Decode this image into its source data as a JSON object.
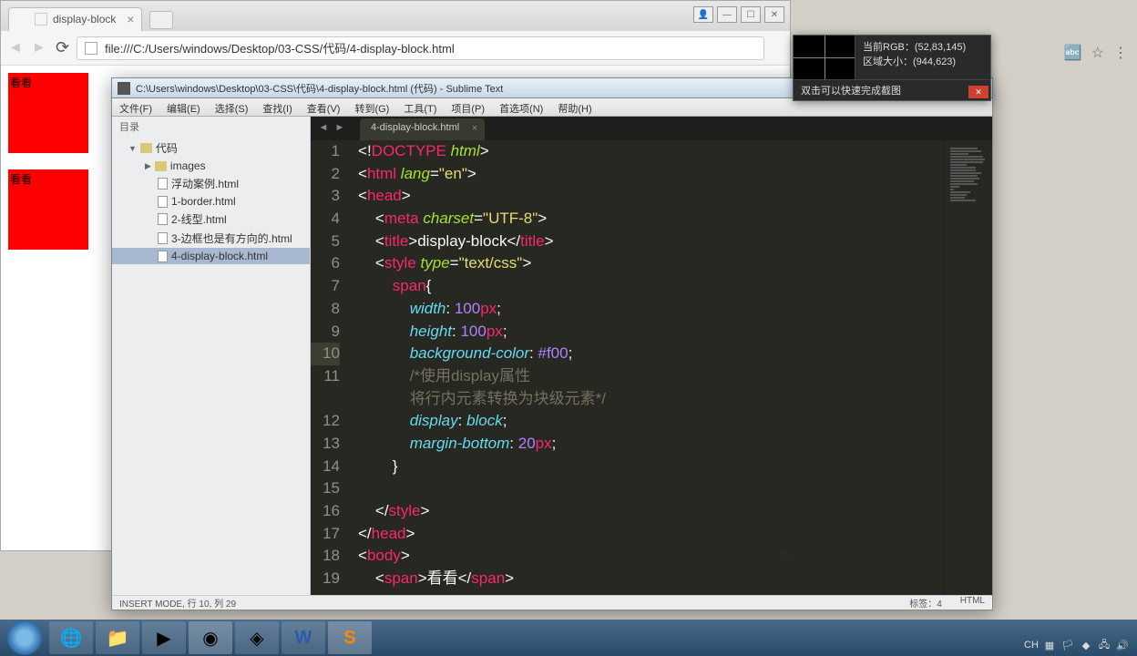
{
  "browser": {
    "tab_title": "display-block",
    "url": "file:///C:/Users/windows/Desktop/03-CSS/代码/4-display-block.html",
    "red_box_text": "看看"
  },
  "sublime": {
    "title": "C:\\Users\\windows\\Desktop\\03-CSS\\代码\\4-display-block.html (代码) - Sublime Text",
    "menu": [
      "文件(F)",
      "编辑(E)",
      "选择(S)",
      "查找(I)",
      "查看(V)",
      "转到(G)",
      "工具(T)",
      "项目(P)",
      "首选项(N)",
      "帮助(H)"
    ],
    "sidebar_header": "目录",
    "tree": {
      "root": "代码",
      "folder": "images",
      "files": [
        "浮动案例.html",
        "1-border.html",
        "2-线型.html",
        "3-边框也是有方向的.html",
        "4-display-block.html"
      ]
    },
    "tab": "4-display-block.html",
    "status_left": "INSERT MODE, 行 10, 列 29",
    "status_tabs": "标签：4",
    "status_lang": "HTML"
  },
  "picker": {
    "rgb_label": "当前RGB：",
    "rgb_val": "(52,83,145)",
    "size_label": "区域大小：",
    "size_val": "(944,623)",
    "hint": "双击可以快速完成截图"
  },
  "code": {
    "lines": [
      {
        "n": "1",
        "seg": [
          [
            "c-text",
            "<"
          ],
          [
            "c-text",
            "!"
          ],
          [
            "c-tag",
            "DOCTYPE"
          ],
          [
            "c-text",
            " "
          ],
          [
            "c-attr",
            "html"
          ],
          [
            "c-text",
            ">"
          ]
        ]
      },
      {
        "n": "2",
        "seg": [
          [
            "c-text",
            "<"
          ],
          [
            "c-tag",
            "html"
          ],
          [
            "c-text",
            " "
          ],
          [
            "c-attr",
            "lang"
          ],
          [
            "c-text",
            "="
          ],
          [
            "c-str",
            "\"en\""
          ],
          [
            "c-text",
            ">"
          ]
        ]
      },
      {
        "n": "3",
        "seg": [
          [
            "c-text",
            "<"
          ],
          [
            "c-tag",
            "head"
          ],
          [
            "c-text",
            ">"
          ]
        ]
      },
      {
        "n": "4",
        "seg": [
          [
            "c-text",
            "    <"
          ],
          [
            "c-tag",
            "meta"
          ],
          [
            "c-text",
            " "
          ],
          [
            "c-attr",
            "charset"
          ],
          [
            "c-text",
            "="
          ],
          [
            "c-str",
            "\"UTF-8\""
          ],
          [
            "c-text",
            ">"
          ]
        ]
      },
      {
        "n": "5",
        "seg": [
          [
            "c-text",
            "    <"
          ],
          [
            "c-tag",
            "title"
          ],
          [
            "c-text",
            ">display-block</"
          ],
          [
            "c-tag",
            "title"
          ],
          [
            "c-text",
            ">"
          ]
        ]
      },
      {
        "n": "6",
        "seg": [
          [
            "c-text",
            "    <"
          ],
          [
            "c-tag",
            "style"
          ],
          [
            "c-text",
            " "
          ],
          [
            "c-attr",
            "type"
          ],
          [
            "c-text",
            "="
          ],
          [
            "c-str",
            "\"text/css\""
          ],
          [
            "c-text",
            ">"
          ]
        ]
      },
      {
        "n": "7",
        "seg": [
          [
            "c-text",
            "        "
          ],
          [
            "c-tag",
            "span"
          ],
          [
            "c-text",
            "{"
          ]
        ]
      },
      {
        "n": "8",
        "seg": [
          [
            "c-text",
            "            "
          ],
          [
            "c-prop",
            "width"
          ],
          [
            "c-text",
            ": "
          ],
          [
            "c-num",
            "100"
          ],
          [
            "c-unit",
            "px"
          ],
          [
            "c-text",
            ";"
          ]
        ]
      },
      {
        "n": "9",
        "seg": [
          [
            "c-text",
            "            "
          ],
          [
            "c-prop",
            "height"
          ],
          [
            "c-text",
            ": "
          ],
          [
            "c-num",
            "100"
          ],
          [
            "c-unit",
            "px"
          ],
          [
            "c-text",
            ";"
          ]
        ]
      },
      {
        "n": "10",
        "cur": true,
        "seg": [
          [
            "c-text",
            "            "
          ],
          [
            "c-prop",
            "background-color"
          ],
          [
            "c-text",
            ": "
          ],
          [
            "c-num",
            "#f00"
          ],
          [
            "c-text",
            ";"
          ]
        ]
      },
      {
        "n": "11",
        "seg": [
          [
            "c-text",
            "            "
          ],
          [
            "c-comment",
            "/*使用display属性"
          ]
        ]
      },
      {
        "n": "11b",
        "seg": [
          [
            "c-text",
            "            "
          ],
          [
            "c-comment",
            "将行内元素转换为块级元素*/"
          ]
        ]
      },
      {
        "n": "12",
        "seg": [
          [
            "c-text",
            "            "
          ],
          [
            "c-prop",
            "display"
          ],
          [
            "c-text",
            ": "
          ],
          [
            "c-prop",
            "block"
          ],
          [
            "c-text",
            ";"
          ]
        ]
      },
      {
        "n": "13",
        "seg": [
          [
            "c-text",
            "            "
          ],
          [
            "c-prop",
            "margin-bottom"
          ],
          [
            "c-text",
            ": "
          ],
          [
            "c-num",
            "20"
          ],
          [
            "c-unit",
            "px"
          ],
          [
            "c-text",
            ";"
          ]
        ]
      },
      {
        "n": "14",
        "seg": [
          [
            "c-text",
            "        }"
          ]
        ]
      },
      {
        "n": "15",
        "seg": [
          [
            "c-text",
            " "
          ]
        ]
      },
      {
        "n": "16",
        "seg": [
          [
            "c-text",
            "    </"
          ],
          [
            "c-tag",
            "style"
          ],
          [
            "c-text",
            ">"
          ]
        ]
      },
      {
        "n": "17",
        "seg": [
          [
            "c-text",
            "</"
          ],
          [
            "c-tag",
            "head"
          ],
          [
            "c-text",
            ">"
          ]
        ]
      },
      {
        "n": "18",
        "seg": [
          [
            "c-text",
            "<"
          ],
          [
            "c-tag",
            "body"
          ],
          [
            "c-text",
            ">"
          ]
        ]
      },
      {
        "n": "19",
        "seg": [
          [
            "c-text",
            "    <"
          ],
          [
            "c-tag",
            "span"
          ],
          [
            "c-text",
            ">看看</"
          ],
          [
            "c-tag",
            "span"
          ],
          [
            "c-text",
            ">"
          ]
        ]
      }
    ],
    "gutter": [
      "1",
      "2",
      "3",
      "4",
      "5",
      "6",
      "7",
      "8",
      "9",
      "10",
      "11",
      "",
      "12",
      "13",
      "14",
      "15",
      "16",
      "17",
      "18",
      "19"
    ]
  }
}
